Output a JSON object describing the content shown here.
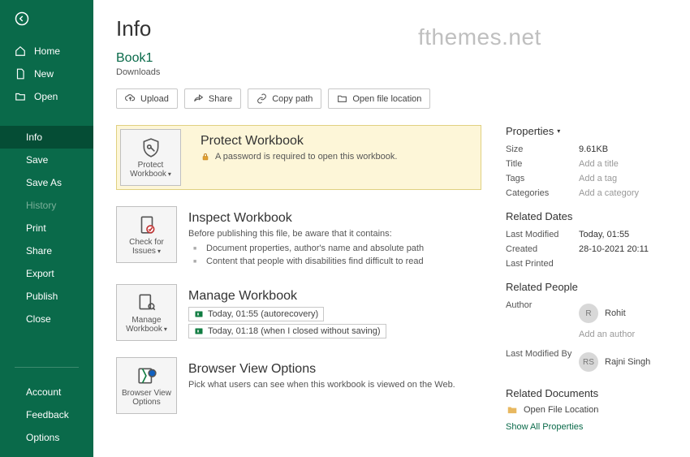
{
  "watermark": "fthemes.net",
  "sidebar": {
    "primary": [
      {
        "label": "Home"
      },
      {
        "label": "New"
      },
      {
        "label": "Open"
      }
    ],
    "secondary": [
      {
        "label": "Info",
        "active": true
      },
      {
        "label": "Save"
      },
      {
        "label": "Save As"
      },
      {
        "label": "History",
        "disabled": true
      },
      {
        "label": "Print"
      },
      {
        "label": "Share"
      },
      {
        "label": "Export"
      },
      {
        "label": "Publish"
      },
      {
        "label": "Close"
      }
    ],
    "footer": [
      {
        "label": "Account"
      },
      {
        "label": "Feedback"
      },
      {
        "label": "Options"
      }
    ]
  },
  "page": {
    "title": "Info",
    "file_title": "Book1",
    "file_path": "Downloads"
  },
  "toolbar": {
    "upload": "Upload",
    "share": "Share",
    "copy_path": "Copy path",
    "open_location": "Open file location"
  },
  "sections": {
    "protect": {
      "tile": "Protect Workbook",
      "title": "Protect Workbook",
      "desc": "A password is required to open this workbook."
    },
    "inspect": {
      "tile": "Check for Issues",
      "title": "Inspect Workbook",
      "desc": "Before publishing this file, be aware that it contains:",
      "bullets": [
        "Document properties, author's name and absolute path",
        "Content that people with disabilities find difficult to read"
      ]
    },
    "manage": {
      "tile": "Manage Workbook",
      "title": "Manage Workbook",
      "versions": [
        "Today, 01:55 (autorecovery)",
        "Today, 01:18 (when I closed without saving)"
      ]
    },
    "browser": {
      "tile": "Browser View Options",
      "title": "Browser View Options",
      "desc": "Pick what users can see when this workbook is viewed on the Web."
    }
  },
  "props": {
    "heading": "Properties",
    "rows": [
      {
        "label": "Size",
        "value": "9.61KB"
      },
      {
        "label": "Title",
        "value": "Add a title",
        "placeholder": true
      },
      {
        "label": "Tags",
        "value": "Add a tag",
        "placeholder": true
      },
      {
        "label": "Categories",
        "value": "Add a category",
        "placeholder": true
      }
    ],
    "dates_heading": "Related Dates",
    "dates": [
      {
        "label": "Last Modified",
        "value": "Today, 01:55"
      },
      {
        "label": "Created",
        "value": "28-10-2021 20:11"
      },
      {
        "label": "Last Printed",
        "value": ""
      }
    ],
    "people_heading": "Related People",
    "author_label": "Author",
    "author": {
      "initials": "R",
      "name": "Rohit"
    },
    "add_author": "Add an author",
    "modified_by_label": "Last Modified By",
    "modified_by": {
      "initials": "RS",
      "name": "Rajni Singh"
    },
    "docs_heading": "Related Documents",
    "open_location": "Open File Location",
    "show_all": "Show All Properties"
  }
}
